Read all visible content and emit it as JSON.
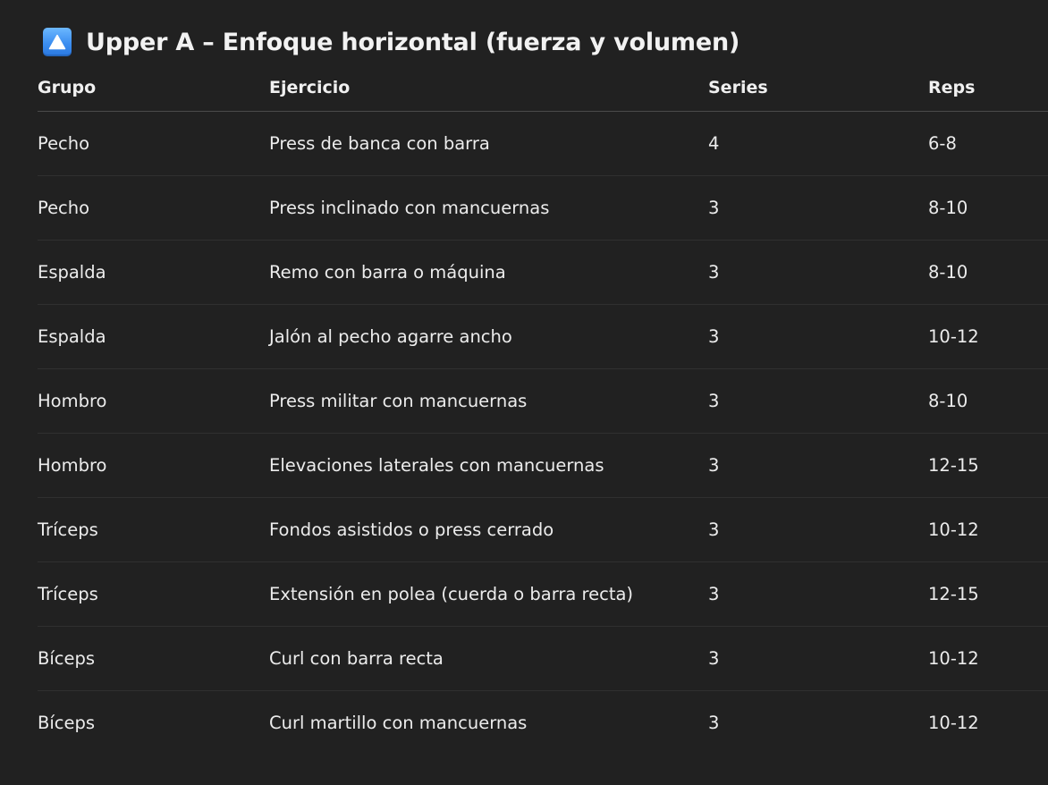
{
  "title": {
    "icon": "up-triangle-icon",
    "text": "Upper A – Enfoque horizontal (fuerza y volumen)"
  },
  "table": {
    "headers": {
      "grupo": "Grupo",
      "ejercicio": "Ejercicio",
      "series": "Series",
      "reps": "Reps"
    },
    "rows": [
      {
        "grupo": "Pecho",
        "ejercicio": "Press de banca con barra",
        "series": "4",
        "reps": "6-8"
      },
      {
        "grupo": "Pecho",
        "ejercicio": "Press inclinado con mancuernas",
        "series": "3",
        "reps": "8-10"
      },
      {
        "grupo": "Espalda",
        "ejercicio": "Remo con barra o máquina",
        "series": "3",
        "reps": "8-10"
      },
      {
        "grupo": "Espalda",
        "ejercicio": "Jalón al pecho agarre ancho",
        "series": "3",
        "reps": "10-12"
      },
      {
        "grupo": "Hombro",
        "ejercicio": "Press militar con mancuernas",
        "series": "3",
        "reps": "8-10"
      },
      {
        "grupo": "Hombro",
        "ejercicio": "Elevaciones laterales con mancuernas",
        "series": "3",
        "reps": "12-15"
      },
      {
        "grupo": "Tríceps",
        "ejercicio": "Fondos asistidos o press cerrado",
        "series": "3",
        "reps": "10-12"
      },
      {
        "grupo": "Tríceps",
        "ejercicio": "Extensión en polea (cuerda o barra recta)",
        "series": "3",
        "reps": "12-15"
      },
      {
        "grupo": "Bíceps",
        "ejercicio": "Curl con barra recta",
        "series": "3",
        "reps": "10-12"
      },
      {
        "grupo": "Bíceps",
        "ejercicio": "Curl martillo con mancuernas",
        "series": "3",
        "reps": "10-12"
      }
    ]
  },
  "colors": {
    "background": "#212121",
    "text": "#ececec",
    "icon_blue": "#3c8ef0"
  }
}
